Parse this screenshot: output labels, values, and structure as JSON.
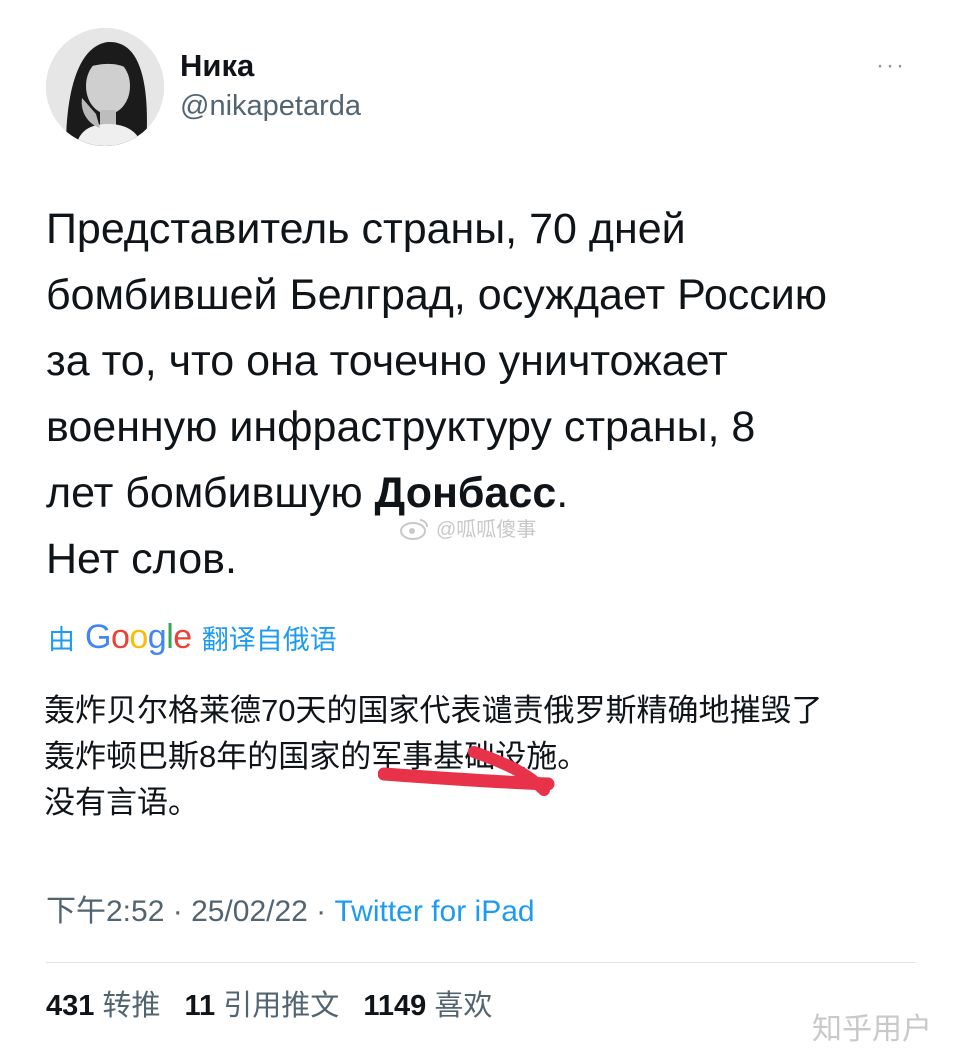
{
  "author": {
    "name": "Ника",
    "handle": "@nikapetarda"
  },
  "more_menu": "···",
  "tweet": {
    "lines": [
      "Представитель страны, 70 дней",
      "бомбившей Белград, осуждает Россию",
      "за то, что она точечно уничтожает",
      "военную инфраструктуру страны, 8"
    ],
    "line5_pre": "лет бомбившую ",
    "line5_bold": "Донбасс",
    "line5_post": ".",
    "line6": "Нет слов."
  },
  "watermark": "@呱呱傻事",
  "translation": {
    "by": "由",
    "brand": "Google",
    "suffix": "翻译自俄语",
    "lines": [
      "轰炸贝尔格莱德70天的国家代表谴责俄罗斯精确地摧毁了",
      "轰炸顿巴斯8年的国家的军事基础设施。",
      "没有言语。"
    ]
  },
  "meta": {
    "time": "下午2:52",
    "sep1": " · ",
    "date": "25/02/22",
    "sep2": " · ",
    "source": "Twitter for iPad"
  },
  "stats": {
    "retweets_count": "431",
    "retweets_label": "转推",
    "quotes_count": "11",
    "quotes_label": "引用推文",
    "likes_count": "1149",
    "likes_label": "喜欢"
  },
  "site_watermark": "知乎用户",
  "colors": {
    "accent": "#1d9bf0",
    "text": "#0f1419",
    "secondary": "#536471",
    "redaction": "#e8324a"
  }
}
